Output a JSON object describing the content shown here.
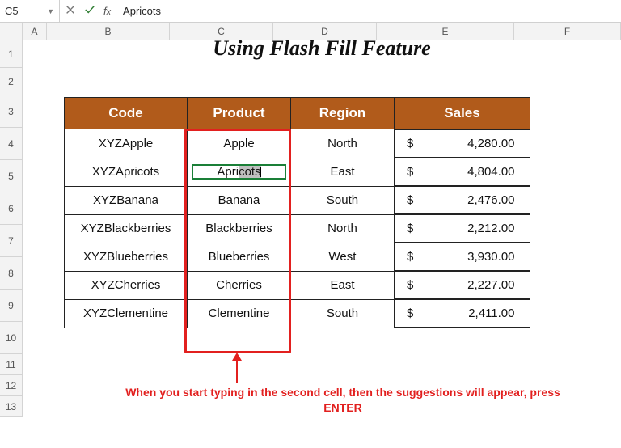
{
  "formula_bar": {
    "cell_ref": "C5",
    "value": "Apricots"
  },
  "columns": [
    "A",
    "B",
    "C",
    "D",
    "E",
    "F"
  ],
  "rows": [
    "1",
    "2",
    "3",
    "4",
    "5",
    "6",
    "7",
    "8",
    "9",
    "10",
    "11",
    "12",
    "13"
  ],
  "title": "Using Flash Fill Feature",
  "headers": {
    "code": "Code",
    "product": "Product",
    "region": "Region",
    "sales": "Sales"
  },
  "currency": "$",
  "data": [
    {
      "code": "XYZApple",
      "product": "Apple",
      "region": "North",
      "sales": "4,280.00",
      "suggested": false
    },
    {
      "code": "XYZApricots",
      "product": "Apricots",
      "region": "East",
      "sales": "4,804.00",
      "suggested": false,
      "editing": true
    },
    {
      "code": "XYZBanana",
      "product": "Banana",
      "region": "South",
      "sales": "2,476.00",
      "suggested": true
    },
    {
      "code": "XYZBlackberries",
      "product": "Blackberries",
      "region": "North",
      "sales": "2,212.00",
      "suggested": true
    },
    {
      "code": "XYZBlueberries",
      "product": "Blueberries",
      "region": "West",
      "sales": "3,930.00",
      "suggested": true
    },
    {
      "code": "XYZCherries",
      "product": "Cherries",
      "region": "East",
      "sales": "2,227.00",
      "suggested": true
    },
    {
      "code": "XYZClementine",
      "product": "Clementine",
      "region": "South",
      "sales": "2,411.00",
      "suggested": true
    }
  ],
  "annotation": "When you start typing in the second cell, then the suggestions will appear, press ENTER",
  "colors": {
    "header_bg": "#b15b1b",
    "highlight": "#e2201f",
    "active": "#1a7f37"
  }
}
